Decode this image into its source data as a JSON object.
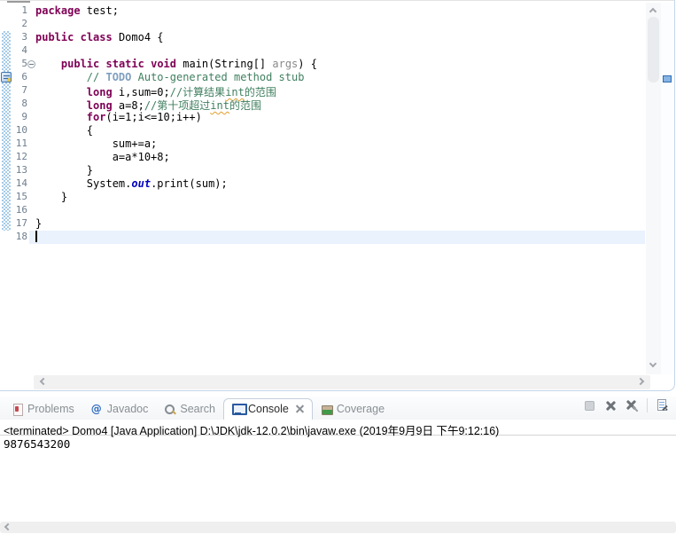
{
  "colors": {
    "keyword": "#7f0055",
    "plain": "#000000",
    "comment": "#3f7f5f",
    "todo_tag": "#7f9fbf",
    "static_field": "#0000c0",
    "parameter": "#8a8a8a",
    "line_number": "#6e7e8e",
    "current_line_bg": "#e9f2fd",
    "quick_diff": "#a6cbe9",
    "spell_underline": "#e0a030",
    "tab_label": "#8a8f94",
    "tab_label_selected": "#2b2b2b"
  },
  "editor": {
    "lines": [
      {
        "num": "1",
        "segs": [
          {
            "c": "kw",
            "t": "package"
          },
          {
            "c": "pl",
            "t": " test;"
          }
        ]
      },
      {
        "num": "2",
        "segs": []
      },
      {
        "num": "3",
        "segs": [
          {
            "c": "kw",
            "t": "public"
          },
          {
            "c": "pl",
            "t": " "
          },
          {
            "c": "kw",
            "t": "class"
          },
          {
            "c": "pl",
            "t": " Domo4 {"
          }
        ]
      },
      {
        "num": "4",
        "segs": []
      },
      {
        "num": "5",
        "fold": true,
        "segs": [
          {
            "c": "pl",
            "t": "    "
          },
          {
            "c": "kw",
            "t": "public"
          },
          {
            "c": "pl",
            "t": " "
          },
          {
            "c": "kw",
            "t": "static"
          },
          {
            "c": "pl",
            "t": " "
          },
          {
            "c": "kw",
            "t": "void"
          },
          {
            "c": "pl",
            "t": " main(String[] "
          },
          {
            "c": "prm",
            "t": "args"
          },
          {
            "c": "pl",
            "t": ") {"
          }
        ]
      },
      {
        "num": "6",
        "task": true,
        "segs": [
          {
            "c": "pl",
            "t": "        "
          },
          {
            "c": "com",
            "t": "// "
          },
          {
            "c": "todo",
            "t": "TODO"
          },
          {
            "c": "com",
            "t": " Auto-generated method stub"
          }
        ]
      },
      {
        "num": "7",
        "segs": [
          {
            "c": "pl",
            "t": "        "
          },
          {
            "c": "kw",
            "t": "long"
          },
          {
            "c": "pl",
            "t": " i,sum=0;"
          },
          {
            "c": "com",
            "t": "//计算结果"
          },
          {
            "c": "spell",
            "t": "int"
          },
          {
            "c": "com",
            "t": "的范围"
          }
        ]
      },
      {
        "num": "8",
        "segs": [
          {
            "c": "pl",
            "t": "        "
          },
          {
            "c": "kw",
            "t": "long"
          },
          {
            "c": "pl",
            "t": " a=8;"
          },
          {
            "c": "com",
            "t": "//第十项超过"
          },
          {
            "c": "spell",
            "t": "int"
          },
          {
            "c": "com",
            "t": "的范围"
          }
        ]
      },
      {
        "num": "9",
        "segs": [
          {
            "c": "pl",
            "t": "        "
          },
          {
            "c": "kw",
            "t": "for"
          },
          {
            "c": "pl",
            "t": "(i=1;i<=10;i++)"
          }
        ]
      },
      {
        "num": "10",
        "segs": [
          {
            "c": "pl",
            "t": "        {"
          }
        ]
      },
      {
        "num": "11",
        "segs": [
          {
            "c": "pl",
            "t": "            sum+=a;"
          }
        ]
      },
      {
        "num": "12",
        "segs": [
          {
            "c": "pl",
            "t": "            a=a*10+8;"
          }
        ]
      },
      {
        "num": "13",
        "segs": [
          {
            "c": "pl",
            "t": "        }"
          }
        ]
      },
      {
        "num": "14",
        "segs": [
          {
            "c": "pl",
            "t": "        System."
          },
          {
            "c": "fld",
            "t": "out"
          },
          {
            "c": "pl",
            "t": ".print(sum);"
          }
        ]
      },
      {
        "num": "15",
        "segs": [
          {
            "c": "pl",
            "t": "    }"
          }
        ]
      },
      {
        "num": "16",
        "segs": []
      },
      {
        "num": "17",
        "segs": [
          {
            "c": "pl",
            "t": "}"
          }
        ]
      },
      {
        "num": "18",
        "current": true,
        "caret": true,
        "segs": []
      }
    ]
  },
  "console": {
    "tabs": [
      {
        "label": "Problems",
        "icon": "problems",
        "selected": false
      },
      {
        "label": "Javadoc",
        "icon": "javadoc",
        "selected": false
      },
      {
        "label": "Search",
        "icon": "search",
        "selected": false
      },
      {
        "label": "Console",
        "icon": "console",
        "selected": true,
        "closable": true
      },
      {
        "label": "Coverage",
        "icon": "coverage",
        "selected": false
      }
    ],
    "toolbar": [
      "Terminate",
      "Remove Launch",
      "Remove All Terminated Launches",
      "Clear Console"
    ],
    "status": "<terminated> Domo4 [Java Application] D:\\JDK\\jdk-12.0.2\\bin\\javaw.exe (2019年9月9日 下午9:12:16)",
    "output": "9876543200"
  }
}
